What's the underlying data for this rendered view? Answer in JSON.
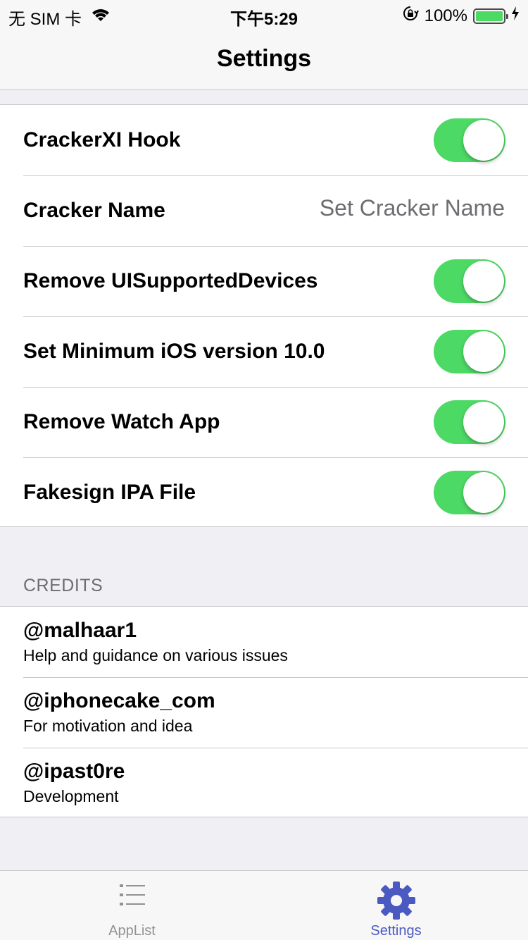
{
  "status_bar": {
    "carrier": "无 SIM 卡",
    "time": "下午5:29",
    "battery_percent": "100%",
    "icons": [
      "wifi-icon",
      "rotation-lock-icon",
      "battery-icon",
      "charging-bolt-icon"
    ]
  },
  "nav": {
    "title": "Settings"
  },
  "settings": {
    "rows": [
      {
        "label": "CrackerXI Hook",
        "type": "toggle",
        "on": true
      },
      {
        "label": "Cracker Name",
        "type": "text",
        "placeholder": "Set Cracker Name"
      },
      {
        "label": "Remove UISupportedDevices",
        "type": "toggle",
        "on": true
      },
      {
        "label": "Set Minimum iOS version 10.0",
        "type": "toggle",
        "on": true
      },
      {
        "label": "Remove Watch App",
        "type": "toggle",
        "on": true
      },
      {
        "label": "Fakesign IPA File",
        "type": "toggle",
        "on": true
      }
    ]
  },
  "credits": {
    "header": "CREDITS",
    "items": [
      {
        "handle": "@malhaar1",
        "description": "Help and guidance on various issues"
      },
      {
        "handle": "@iphonecake_com",
        "description": "For motivation and idea"
      },
      {
        "handle": "@ipast0re",
        "description": "Development"
      }
    ]
  },
  "tab_bar": {
    "tabs": [
      {
        "label": "AppList",
        "icon": "list-icon",
        "selected": false
      },
      {
        "label": "Settings",
        "icon": "gear-icon",
        "selected": true
      }
    ]
  },
  "colors": {
    "toggle_on": "#4cd964",
    "tab_selected": "#4a5ac0",
    "tab_unselected": "#929292",
    "background": "#efeff4"
  }
}
